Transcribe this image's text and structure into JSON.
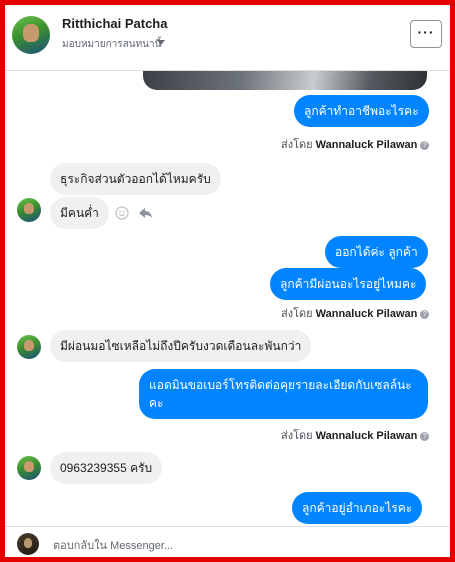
{
  "header": {
    "name": "Ritthichai Patcha",
    "subtitle": "มอบหมายการสนทนานี้",
    "more_label": "···"
  },
  "messages": {
    "m1": "ลูกค้าทำอาชีพอะไรคะ",
    "sent1": {
      "prefix": "ส่งโดย",
      "name": "Wannaluck Pilawan"
    },
    "m2": "ธุระกิจส่วนตัวออกได้ไหมครับ",
    "m3": "มีคนค่ำ",
    "m4": "ออกได้ค่ะ ลูกค้า",
    "m5": "ลูกค้ามีผ่อนอะไรอยู่ไหมคะ",
    "sent2": {
      "prefix": "ส่งโดย",
      "name": "Wannaluck Pilawan"
    },
    "m6": "มีผ่อนมอไซเหลือไม่ถึงปีครับงวดเดือนละพันกว่า",
    "m7": "แอดมินขอเบอร์โทรติดต่อคุยรายละเอียดกับเซลล์นะคะ",
    "sent3": {
      "prefix": "ส่งโดย",
      "name": "Wannaluck Pilawan"
    },
    "m8": "0963239355 ครับ",
    "m9": "ลูกค้าอยู่อำเภอะไรคะ"
  },
  "footer": {
    "reply_placeholder": "ตอบกลับใน Messenger..."
  },
  "colors": {
    "outgoing": "#0084ff",
    "incoming": "#f1f0f0",
    "border": "#e50000"
  },
  "icons": [
    "more-icon",
    "caret-down-icon",
    "smiley-icon",
    "reply-arrow-icon",
    "help-icon"
  ]
}
